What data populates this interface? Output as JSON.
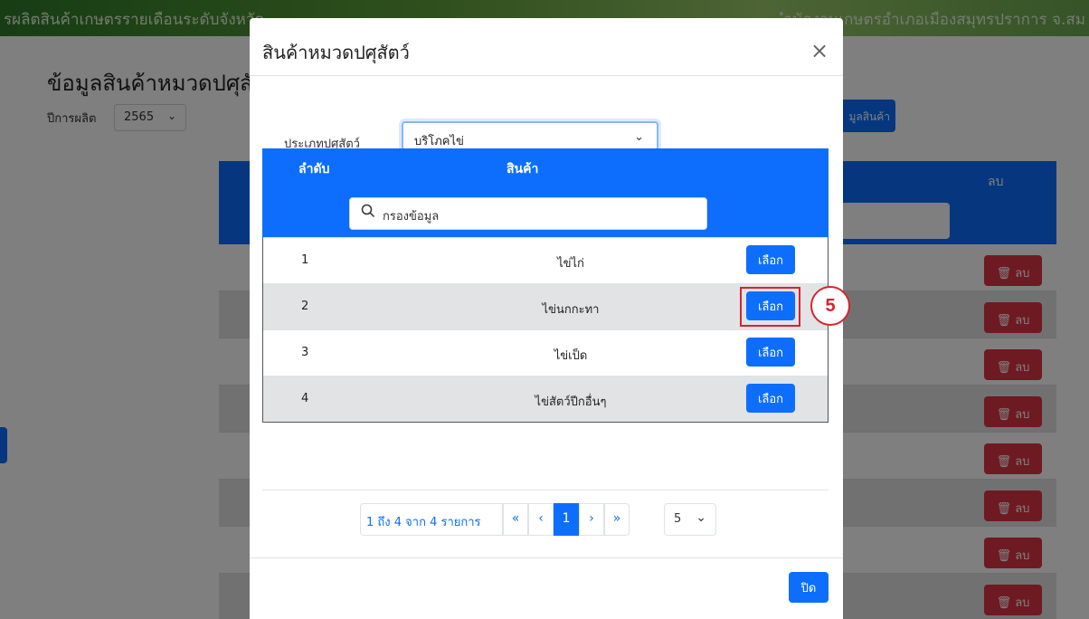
{
  "background": {
    "topbar_title": "รผลิตสินค้าเกษตรรายเดือนระดับจังหวัด",
    "topbar_right": "ำนักงานเกษตรอำเภอเมืองสมุทรปราการ จ.สม",
    "page_heading": "ข้อมูลสินค้าหมวดปศุสัตว์",
    "year_label": "ปีการผลิต",
    "year_value": "2565",
    "add_button": "มูลสินค้า",
    "col_delete": "ลบ",
    "delete_label": "ลบ"
  },
  "modal": {
    "title": "สินค้าหมวดปศุสัตว์",
    "close_symbol": "×",
    "type_label": "ประเภทปศุสัตว์",
    "type_value": "บริโภคไข่",
    "col_no": "ลำดับ",
    "col_product": "สินค้า",
    "filter_placeholder": "กรองข้อมูล",
    "rows": [
      {
        "no": "1",
        "name": "ไข่ไก่",
        "action": "เลือก"
      },
      {
        "no": "2",
        "name": "ไข่นกกะทา",
        "action": "เลือก"
      },
      {
        "no": "3",
        "name": "ไข่เป็ด",
        "action": "เลือก"
      },
      {
        "no": "4",
        "name": "ไข่สัตว์ปีกอื่นๆ",
        "action": "เลือก"
      }
    ],
    "step_marker": "5",
    "pagination": {
      "info": "1 ถึง 4 จาก 4 รายการ",
      "first": "«",
      "prev": "‹",
      "current": "1",
      "next": "›",
      "last": "»",
      "page_size": "5"
    },
    "close_button": "ปิด"
  },
  "colors": {
    "primary": "#0d6efd",
    "danger": "#dc3545",
    "annotation": "#d9232d"
  }
}
